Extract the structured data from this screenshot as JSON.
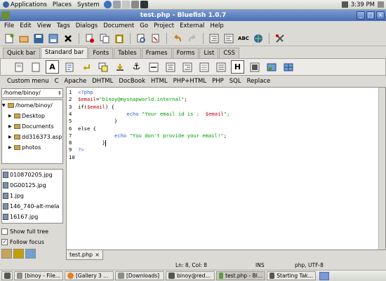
{
  "top_panel": {
    "menus": [
      "Applications",
      "Places",
      "System"
    ],
    "launcher_icons": [
      "web-browser-icon",
      "mail-icon",
      "notes-icon",
      "calendar-icon",
      "terminal-icon"
    ],
    "clock": "3:39 PM"
  },
  "window": {
    "title": "test.php - Bluefish 1.0.7",
    "controls": {
      "minimize": "_",
      "maximize": "□",
      "close": "×"
    }
  },
  "menubar": [
    "File",
    "Edit",
    "View",
    "Tags",
    "Dialogs",
    "Document",
    "Go",
    "Project",
    "External",
    "Help"
  ],
  "toolbar_icons": [
    "new-file-icon",
    "open-icon",
    "save-icon",
    "save-as-icon",
    "close-icon",
    "cut-icon",
    "copy-icon",
    "paste-icon",
    "find-icon",
    "replace-icon",
    "undo-icon",
    "redo-icon",
    "indent-icon",
    "unindent-icon",
    "spellcheck-icon",
    "preview-icon",
    "settings-icon"
  ],
  "tabs": [
    "Quick bar",
    "Standard bar",
    "Fonts",
    "Tables",
    "Frames",
    "Forms",
    "List",
    "CSS"
  ],
  "active_tab": "Standard bar",
  "quick_icons": [
    "page-icon",
    "page-blank-icon",
    "anchor-a-icon",
    "anchor-text-icon",
    "break-icon",
    "paragraph-icon",
    "nbsp-icon",
    "anchor-icon",
    "rule-icon",
    "center-icon",
    "right-icon",
    "comment-icon",
    "email-icon",
    "header-icon",
    "image-icon",
    "thumbnail-icon",
    "table-icon"
  ],
  "quick_bold_glyphs": {
    "a": "A",
    "h": "H"
  },
  "custom_menu": [
    "Custom menu",
    "C",
    "Apache",
    "DHTML",
    "DocBook",
    "HTML",
    "PHP+HTML",
    "PHP",
    "SQL",
    "Replace"
  ],
  "sidebar": {
    "path": "/home/binoy/",
    "tree": [
      {
        "label": "/home/binoy/",
        "level": 0,
        "expanded": true
      },
      {
        "label": "Desktop",
        "level": 1
      },
      {
        "label": "Documents",
        "level": 1
      },
      {
        "label": "dd316373.asp",
        "level": 1
      },
      {
        "label": "photos",
        "level": 1
      }
    ],
    "files": [
      "010870205.jpg",
      "0G00125.jpg",
      "1.jpg",
      "146_740-alt-mela",
      "16167.jpg"
    ],
    "show_full_tree": {
      "label": "Show full tree",
      "checked": false
    },
    "follow_focus": {
      "label": "Follow focus",
      "checked": true
    }
  },
  "editor": {
    "lines": [
      {
        "n": "1",
        "parts": [
          {
            "t": "<?php",
            "c": "tag"
          }
        ]
      },
      {
        "n": "2",
        "parts": [
          {
            "t": "$email",
            "c": "var"
          },
          {
            "t": "=",
            "c": "kw"
          },
          {
            "t": "\"binoy@mysnapworld.internal\"",
            "c": "str"
          },
          {
            "t": ";",
            "c": "kw"
          }
        ]
      },
      {
        "n": "3",
        "parts": [
          {
            "t": "if(",
            "c": "kw"
          },
          {
            "t": "$email",
            "c": "var"
          },
          {
            "t": ") {",
            "c": "kw"
          }
        ]
      },
      {
        "n": "4",
        "parts": [
          {
            "t": "                ",
            "c": "kw"
          },
          {
            "t": "echo",
            "c": "fn"
          },
          {
            "t": " \"Your email id is :  ",
            "c": "str"
          },
          {
            "t": "$email",
            "c": "var"
          },
          {
            "t": "\";",
            "c": "str"
          }
        ]
      },
      {
        "n": "5",
        "parts": [
          {
            "t": "            }",
            "c": "kw"
          }
        ]
      },
      {
        "n": "6",
        "parts": [
          {
            "t": "else {",
            "c": "kw"
          }
        ]
      },
      {
        "n": "7",
        "parts": [
          {
            "t": "            ",
            "c": "kw"
          },
          {
            "t": "echo",
            "c": "fn"
          },
          {
            "t": " \"You don't provide your email!\"",
            "c": "str"
          },
          {
            "t": ";",
            "c": "kw"
          }
        ]
      },
      {
        "n": "8",
        "parts": [
          {
            "t": "        }",
            "c": "kw"
          }
        ]
      },
      {
        "n": "9",
        "parts": [
          {
            "t": "?>",
            "c": "tag"
          }
        ]
      },
      {
        "n": "10",
        "parts": []
      }
    ],
    "doc_tab": "test.php",
    "doc_tab_close": "×"
  },
  "status": {
    "position": "Ln: 8, Col: 8",
    "mode": "INS",
    "encoding": "php, UTF-8"
  },
  "taskbar": [
    {
      "label": "[binoy - File...",
      "icon_color": "#8e8c87"
    },
    {
      "label": "[Gallery 3 ...",
      "icon_color": "#e67e22"
    },
    {
      "label": "[Downloads]",
      "icon_color": "#8e8c87"
    },
    {
      "label": "binoy@red...",
      "icon_color": "#555753"
    },
    {
      "label": "test.php - Bl...",
      "icon_color": "#5c9b3a",
      "active": true
    },
    {
      "label": "Starting Tak...",
      "icon_color": "#555753"
    }
  ],
  "colors": {
    "accent": "#4a6fb5",
    "php_tag": "#2a5bd7",
    "variable": "#c00000",
    "string": "#009a00"
  }
}
